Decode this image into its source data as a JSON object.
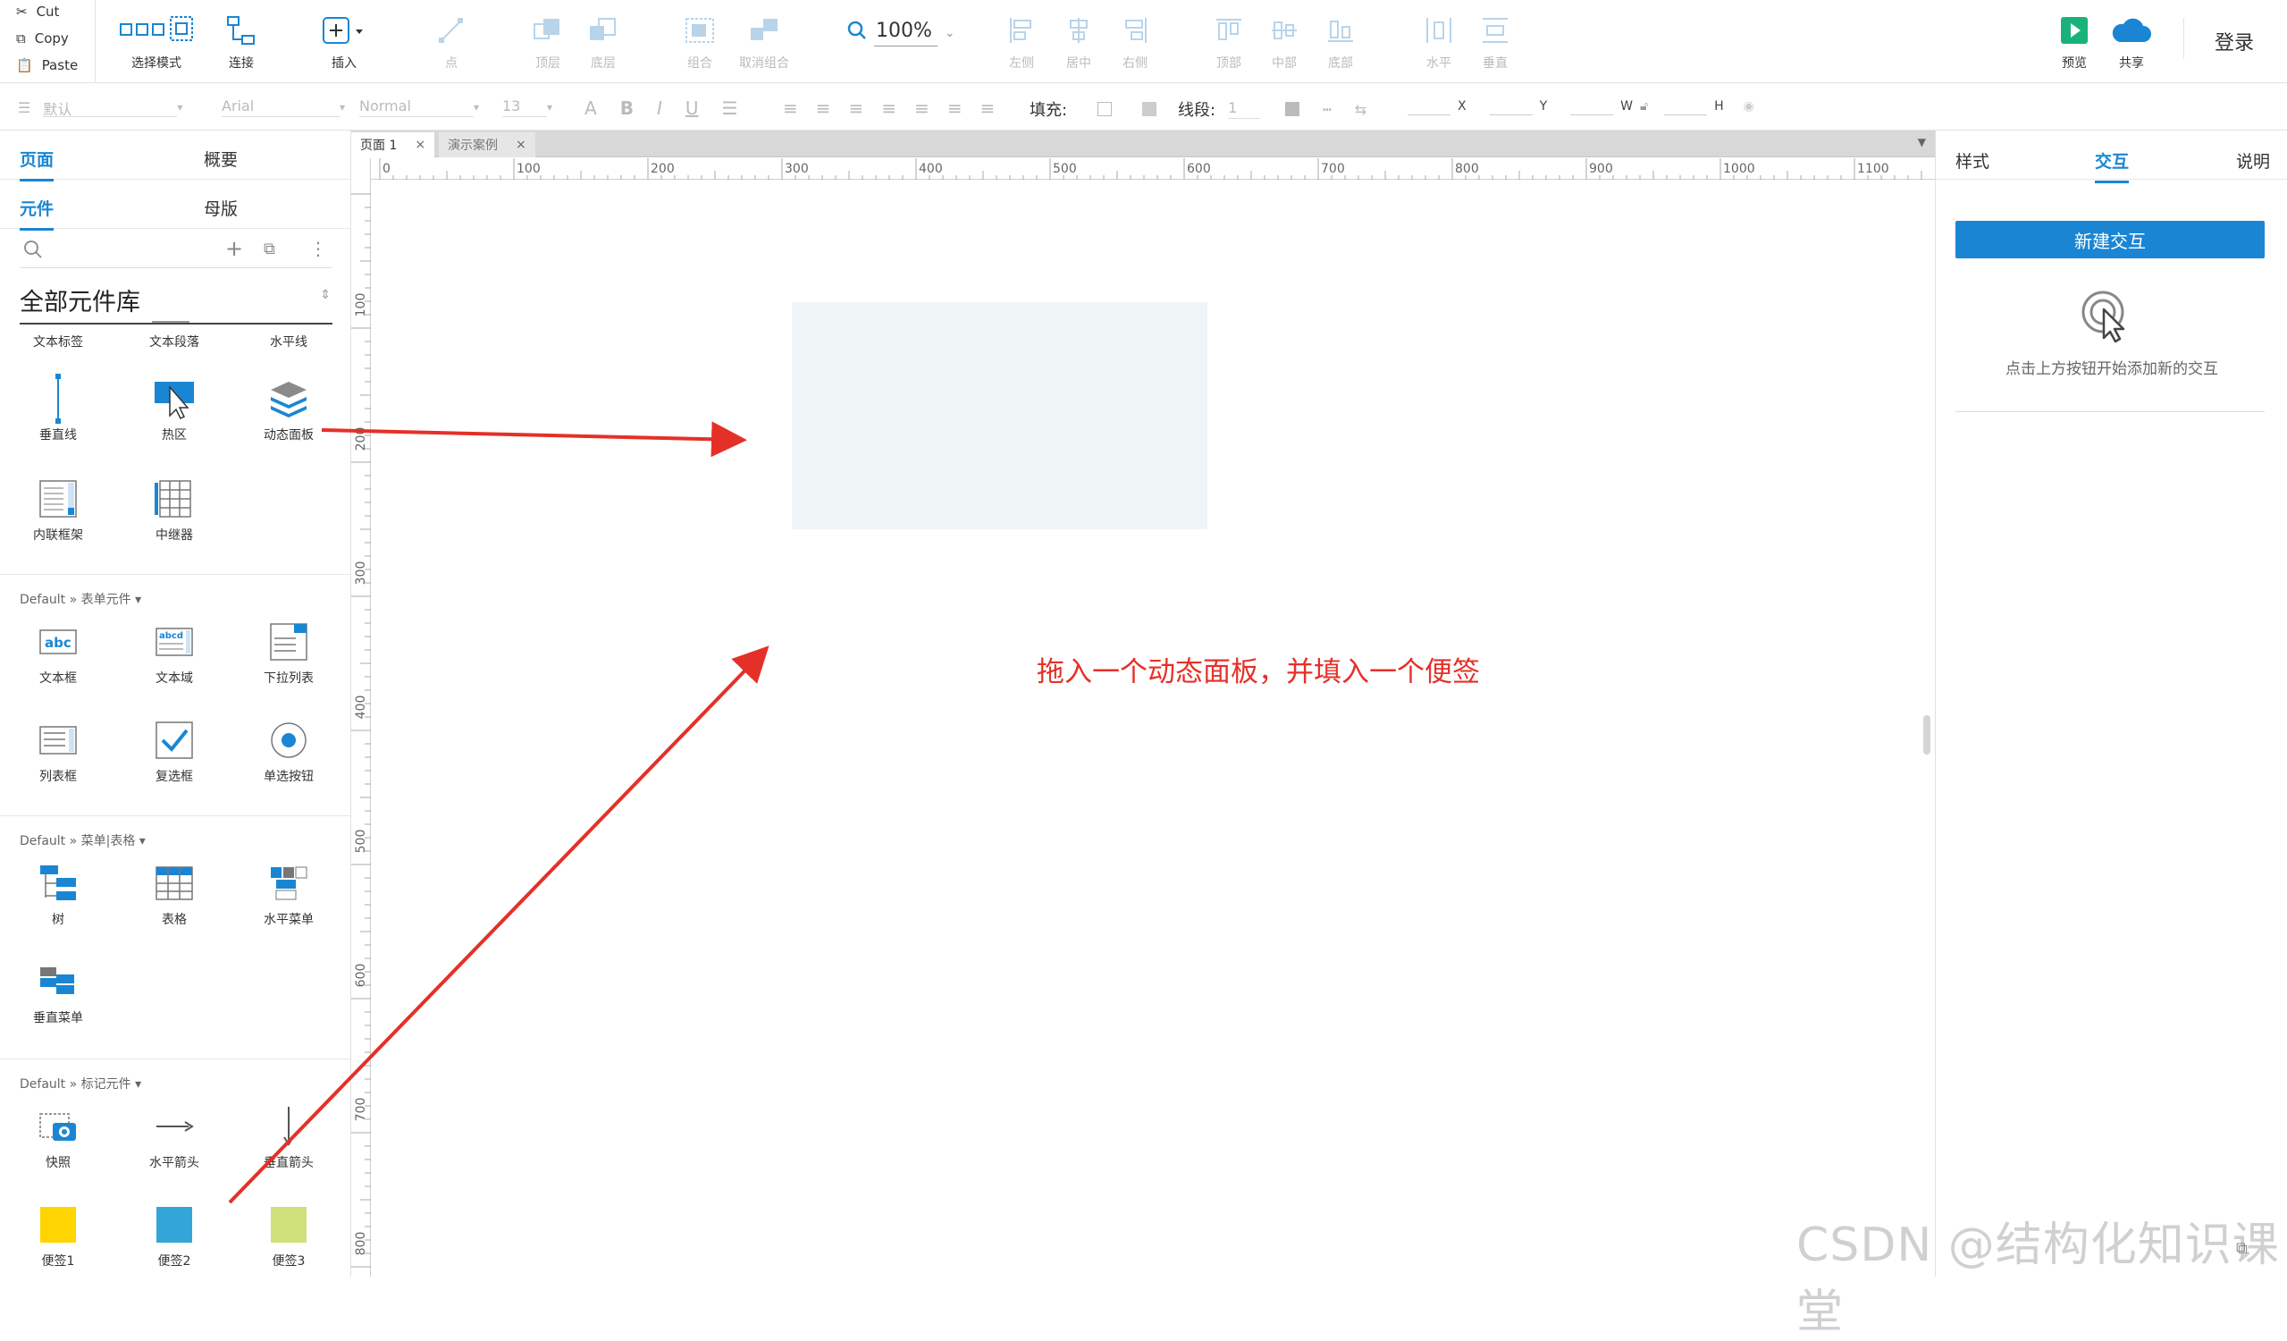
{
  "clipboard": {
    "cut": "Cut",
    "copy": "Copy",
    "paste": "Paste"
  },
  "toolbar": {
    "select_mode": "选择模式",
    "connect": "连接",
    "insert": "插入",
    "point": "点",
    "top_layer": "顶层",
    "bottom_layer": "底层",
    "group": "组合",
    "ungroup": "取消组合",
    "zoom": "100%",
    "align_left": "左侧",
    "align_center": "居中",
    "align_right": "右侧",
    "align_top": "顶部",
    "align_middle": "中部",
    "align_bottom": "底部",
    "dist_horizontal": "水平",
    "dist_vertical": "垂直",
    "preview": "预览",
    "share": "共享",
    "login": "登录"
  },
  "format": {
    "style": "默认",
    "font": "Arial",
    "weight": "Normal",
    "size": "13",
    "fill_label": "填充:",
    "line_label": "线段:",
    "line_value": "1",
    "x": "X",
    "y": "Y",
    "w": "W",
    "h": "H"
  },
  "left": {
    "tab_pages": "页面",
    "tab_outline": "概要",
    "tab_widgets": "元件",
    "tab_masters": "母版",
    "library": "全部元件库",
    "row0": [
      "文本标签",
      "文本段落",
      "水平线"
    ],
    "basic": [
      "垂直线",
      "热区",
      "动态面板",
      "内联框架",
      "中继器"
    ],
    "section_form": "Default » 表单元件 ▾",
    "form": [
      "文本框",
      "文本域",
      "下拉列表",
      "列表框",
      "复选框",
      "单选按钮"
    ],
    "section_menu": "Default » 菜单|表格 ▾",
    "menu": [
      "树",
      "表格",
      "水平菜单",
      "垂直菜单"
    ],
    "section_markup": "Default » 标记元件 ▾",
    "markup": [
      "快照",
      "水平箭头",
      "垂直箭头",
      "便签1",
      "便签2",
      "便签3"
    ]
  },
  "doc_tabs": [
    "页面 1",
    "演示案例"
  ],
  "ruler_h": [
    "0",
    "100",
    "200",
    "300",
    "400",
    "500",
    "600",
    "700",
    "800",
    "900",
    "1000",
    "1100"
  ],
  "ruler_v": [
    "100",
    "200",
    "300",
    "400",
    "500",
    "600",
    "700",
    "800"
  ],
  "annotation": "拖入一个动态面板，并填入一个便签",
  "right": {
    "tab_style": "样式",
    "tab_interaction": "交互",
    "tab_notes": "说明",
    "new_button": "新建交互",
    "hint": "点击上方按钮开始添加新的交互"
  },
  "watermark": "CSDN @结构化知识课堂",
  "colors": {
    "accent": "#1a86d3",
    "annotation_red": "#e53028",
    "sticky1": "#ffd400",
    "sticky2": "#33a5d9",
    "sticky3": "#cfe07a"
  }
}
